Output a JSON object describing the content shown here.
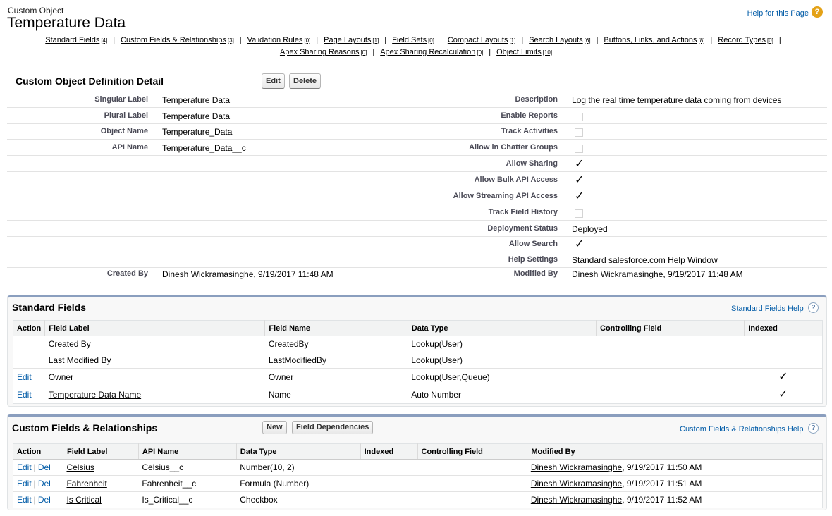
{
  "header": {
    "object_type": "Custom Object",
    "title": "Temperature Data",
    "help_link": "Help for this Page"
  },
  "related_links": {
    "row1": [
      {
        "label": "Standard Fields",
        "count": "[4]"
      },
      {
        "label": "Custom Fields & Relationships",
        "count": "[3]"
      },
      {
        "label": "Validation Rules",
        "count": "[0]"
      },
      {
        "label": "Page Layouts",
        "count": "[1]"
      },
      {
        "label": "Field Sets",
        "count": "[0]"
      },
      {
        "label": "Compact Layouts",
        "count": "[1]"
      },
      {
        "label": "Search Layouts",
        "count": "[6]"
      },
      {
        "label": "Buttons, Links, and Actions",
        "count": "[8]"
      },
      {
        "label": "Record Types",
        "count": "[0]"
      }
    ],
    "row2": [
      {
        "label": "Apex Sharing Reasons",
        "count": "[0]"
      },
      {
        "label": "Apex Sharing Recalculation",
        "count": "[0]"
      },
      {
        "label": "Object Limits",
        "count": "[10]"
      }
    ],
    "separator": "|"
  },
  "detail": {
    "title": "Custom Object Definition Detail",
    "edit_button": "Edit",
    "delete_button": "Delete",
    "left": [
      {
        "label": "Singular Label",
        "value": "Temperature Data"
      },
      {
        "label": "Plural Label",
        "value": "Temperature Data"
      },
      {
        "label": "Object Name",
        "value": "Temperature_Data"
      },
      {
        "label": "API Name",
        "value": "Temperature_Data__c"
      }
    ],
    "right": [
      {
        "label": "Description",
        "value": "Log the real time temperature data coming from devices"
      },
      {
        "label": "Enable Reports",
        "checked": false
      },
      {
        "label": "Track Activities",
        "checked": false
      },
      {
        "label": "Allow in Chatter Groups",
        "checked": false
      },
      {
        "label": "Allow Sharing",
        "checked": true
      },
      {
        "label": "Allow Bulk API Access",
        "checked": true
      },
      {
        "label": "Allow Streaming API Access",
        "checked": true
      },
      {
        "label": "Track Field History",
        "checked": false
      },
      {
        "label": "Deployment Status",
        "value": "Deployed"
      },
      {
        "label": "Allow Search",
        "checked": true
      },
      {
        "label": "Help Settings",
        "value": "Standard salesforce.com Help Window"
      }
    ],
    "created_by_label": "Created By",
    "created_by_user": "Dinesh Wickramasinghe",
    "created_by_date": ", 9/19/2017 11:48 AM",
    "modified_by_label": "Modified By",
    "modified_by_user": "Dinesh Wickramasinghe",
    "modified_by_date": ", 9/19/2017 11:48 AM",
    "check_glyph": "✓"
  },
  "standard_fields": {
    "title": "Standard Fields",
    "help": "Standard Fields Help",
    "columns": [
      "Action",
      "Field Label",
      "Field Name",
      "Data Type",
      "Controlling Field",
      "Indexed"
    ],
    "rows": [
      {
        "action": "",
        "label": "Created By",
        "name": "CreatedBy",
        "type": "Lookup(User)",
        "controlling": "",
        "indexed": false
      },
      {
        "action": "",
        "label": "Last Modified By",
        "name": "LastModifiedBy",
        "type": "Lookup(User)",
        "controlling": "",
        "indexed": false
      },
      {
        "action": "Edit",
        "label": "Owner",
        "name": "Owner",
        "type": "Lookup(User,Queue)",
        "controlling": "",
        "indexed": true
      },
      {
        "action": "Edit",
        "label": "Temperature Data Name",
        "name": "Name",
        "type": "Auto Number",
        "controlling": "",
        "indexed": true
      }
    ]
  },
  "custom_fields": {
    "title": "Custom Fields & Relationships",
    "new_button": "New",
    "deps_button": "Field Dependencies",
    "help": "Custom Fields & Relationships Help",
    "columns": [
      "Action",
      "Field Label",
      "API Name",
      "Data Type",
      "Indexed",
      "Controlling Field",
      "Modified By"
    ],
    "edit_label": "Edit",
    "del_label": "Del",
    "rows": [
      {
        "label": "Celsius",
        "api": "Celsius__c",
        "type": "Number(10, 2)",
        "indexed": "",
        "controlling": "",
        "modified_user": "Dinesh Wickramasinghe",
        "modified_date": ", 9/19/2017 11:50 AM"
      },
      {
        "label": "Fahrenheit",
        "api": "Fahrenheit__c",
        "type": "Formula (Number)",
        "indexed": "",
        "controlling": "",
        "modified_user": "Dinesh Wickramasinghe",
        "modified_date": ", 9/19/2017 11:51 AM"
      },
      {
        "label": "Is Critical",
        "api": "Is_Critical__c",
        "type": "Checkbox",
        "indexed": "",
        "controlling": "",
        "modified_user": "Dinesh Wickramasinghe",
        "modified_date": ", 9/19/2017 11:52 AM"
      }
    ]
  }
}
